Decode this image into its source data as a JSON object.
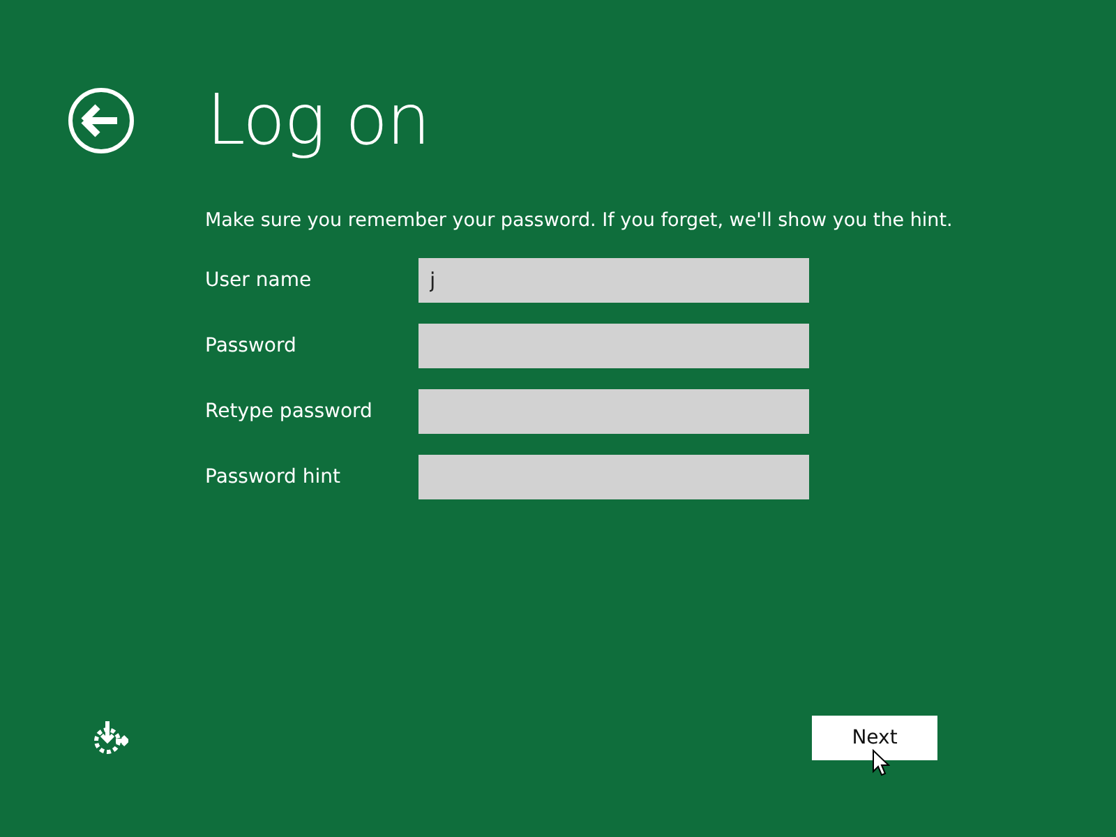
{
  "title": "Log on",
  "instruction": "Make sure you remember your password. If you forget, we'll show you the hint.",
  "fields": [
    {
      "label": "User name",
      "value": "j"
    },
    {
      "label": "Password"
    },
    {
      "label": "Retype password"
    },
    {
      "label": "Password hint"
    }
  ],
  "next_button": "Next"
}
